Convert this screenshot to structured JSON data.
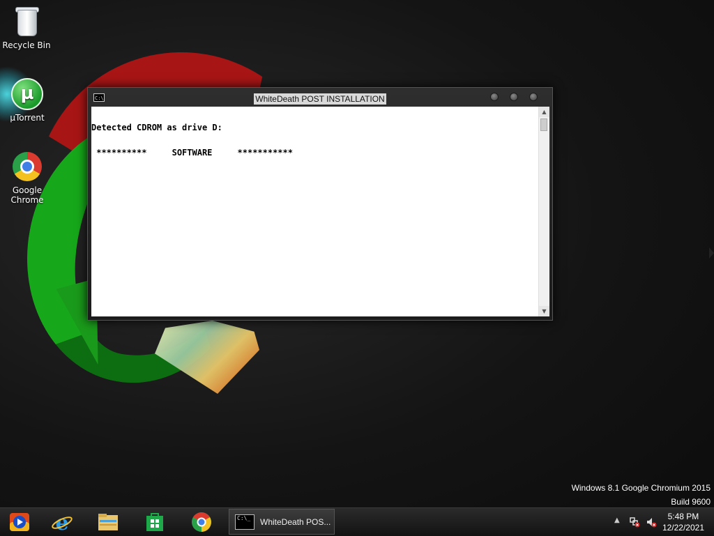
{
  "desktop": {
    "icons": [
      {
        "label": "Recycle Bin",
        "icon": "recycle-bin-icon"
      },
      {
        "label": "µTorrent",
        "icon": "utorrent-icon",
        "glyph": "µ"
      },
      {
        "label": "Google\nChrome",
        "icon": "chrome-icon"
      }
    ]
  },
  "window": {
    "title": "WhiteDeath POST INSTALLATION",
    "sys_icon_text": "C:\\",
    "console_lines": [
      "Detected CDROM as drive D:",
      " **********     SOFTWARE     ***********"
    ]
  },
  "watermark": {
    "line1": "Windows 8.1 Google Chromium 2015",
    "line2": "Build 9600"
  },
  "taskbar": {
    "pinned": [
      "windows-media-player-icon",
      "internet-explorer-icon",
      "file-explorer-icon",
      "store-icon",
      "chrome-icon"
    ],
    "active_window_label": "WhiteDeath POS...",
    "active_window_icon_text": "C:\\_",
    "tray": {
      "show_hidden_arrow": "▲",
      "time": "5:48 PM",
      "date": "12/22/2021"
    }
  },
  "colors": {
    "console_bg": "#ffffff",
    "console_text": "#000000",
    "taskbar_bg": "#1c1c1c"
  }
}
